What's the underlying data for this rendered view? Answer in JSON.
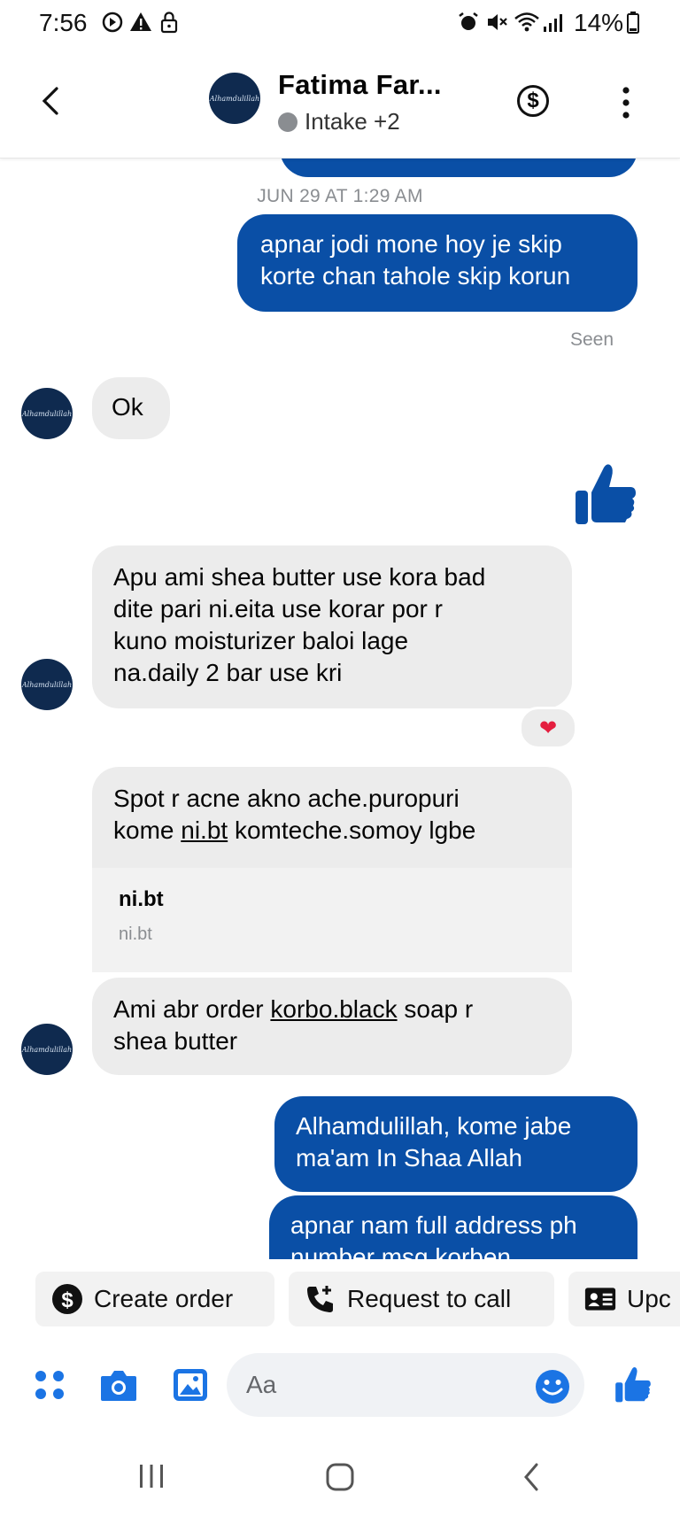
{
  "status_bar": {
    "time": "7:56",
    "battery": "14%"
  },
  "header": {
    "contact_name": "Fatima Far...",
    "subtitle": "Intake +2",
    "icons": [
      "back-icon",
      "avatar",
      "dollar-icon",
      "more-vertical-icon"
    ]
  },
  "thread": {
    "timestamp": "JUN 29 AT 1:29 AM",
    "seen_label": "Seen",
    "messages": [
      {
        "id": "m1",
        "direction": "out",
        "text_lines": [
          "apnar jodi mone hoy je skip",
          "korte chan tahole skip korun"
        ]
      },
      {
        "id": "m2",
        "direction": "in",
        "text": "Ok"
      },
      {
        "id": "m3",
        "direction": "out",
        "type": "like"
      },
      {
        "id": "m4",
        "direction": "in",
        "text_lines": [
          "Apu ami shea butter use kora bad",
          "dite pari ni.eita use korar por r",
          "kuno moisturizer baloi lage",
          "na.daily 2 bar use kri"
        ],
        "reaction": "heart"
      },
      {
        "id": "m5",
        "direction": "in",
        "text_line1": "Spot r acne akno ache.puropuri",
        "text_line2_pre": "kome ",
        "text_line2_link": "ni.bt",
        "text_line2_post": " komteche.somoy lgbe",
        "link_preview": {
          "title": "ni.bt",
          "domain": "ni.bt"
        }
      },
      {
        "id": "m6",
        "direction": "in",
        "text_line1_pre": "Ami abr order ",
        "text_line1_link": "korbo.black",
        "text_line1_post": " soap r",
        "text_line2": "shea butter"
      },
      {
        "id": "m7",
        "direction": "out",
        "text_lines": [
          "Alhamdulillah,  kome jabe",
          "ma'am In Shaa Allah"
        ]
      },
      {
        "id": "m8",
        "direction": "out",
        "text_lines": [
          "apnar nam full address ph",
          "number msg korben"
        ]
      }
    ]
  },
  "quick_actions": [
    {
      "label": "Create order",
      "icon": "dollar-circle-icon"
    },
    {
      "label": "Request to call",
      "icon": "phone-plus-icon"
    },
    {
      "label": "Upc",
      "icon": "id-card-icon"
    }
  ],
  "composer": {
    "placeholder": "Aa",
    "icons": [
      "apps-icon",
      "camera-icon",
      "image-icon",
      "emoji-icon",
      "like-icon"
    ]
  },
  "colors": {
    "accent": "#0a4fa6",
    "composer_blue": "#1b74e4",
    "incoming_bubble": "#ececec",
    "heart": "#e41e3f"
  }
}
